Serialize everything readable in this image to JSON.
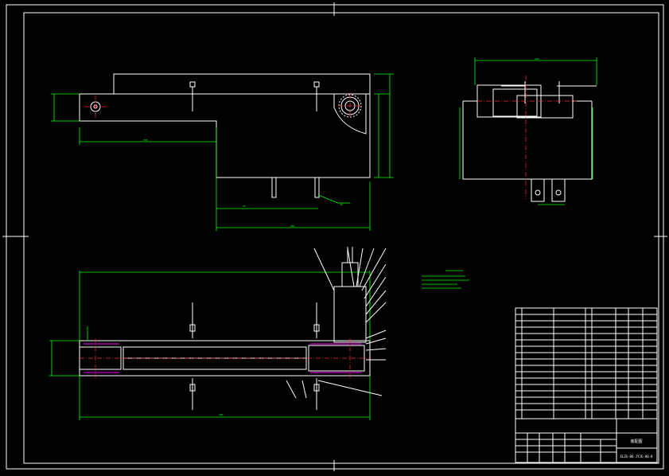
{
  "title_block": {
    "drawing_title": "装配图",
    "drawing_number": "ELZG-B6-JYJG-00-0"
  },
  "part_rows": [],
  "colors": {
    "background": "#000000",
    "outline": "#ffffff",
    "dimension": "#00ff00",
    "centerline": "#ff3030",
    "hidden": "#ff00ff"
  }
}
